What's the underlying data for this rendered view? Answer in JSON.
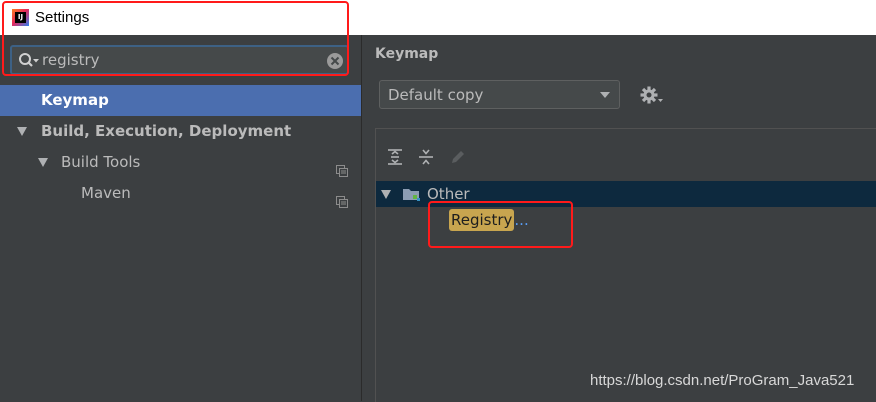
{
  "window": {
    "title": "Settings",
    "app_icon": "intellij-idea-icon"
  },
  "search": {
    "value": "registry",
    "icon": "search-icon",
    "clear_icon": "clear-icon"
  },
  "sidebar": {
    "items": [
      {
        "label": "Keymap",
        "selected": true
      },
      {
        "label": "Build, Execution, Deployment",
        "expanded": true
      },
      {
        "label": "Build Tools",
        "expanded": true
      },
      {
        "label": "Maven"
      }
    ]
  },
  "keymap": {
    "title": "Keymap",
    "scheme_value": "Default copy",
    "gear_icon": "gear-icon",
    "toolbar_icons": [
      "expand-all-icon",
      "collapse-all-icon",
      "edit-icon"
    ],
    "tree": {
      "group_label": "Other",
      "action_match": "Registry",
      "action_suffix": "..."
    }
  },
  "watermark": "https://blog.csdn.net/ProGram_Java521",
  "colors": {
    "selection": "#4b6eaf",
    "highlight": "#c8a54f",
    "annotation_red": "#ff1a1a",
    "tree_selected_row": "#0d293e"
  }
}
